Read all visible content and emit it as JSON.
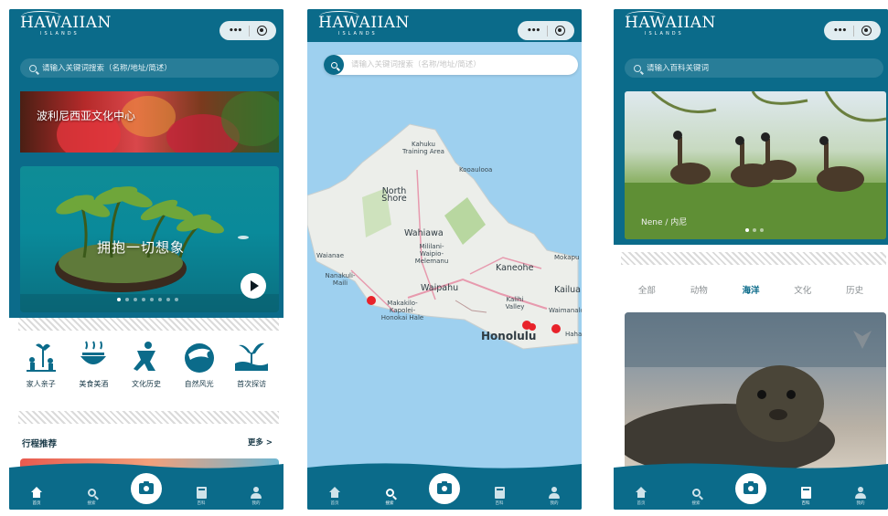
{
  "screens": [
    {
      "logo": {
        "main": "HAWAIIAN",
        "sub": "ISLANDS"
      },
      "search_placeholder": "请输入关键词搜索（名称/地址/简述）",
      "banner_title": "波利尼西亚文化中心",
      "hero_title": "拥抱一切想象",
      "carousel_dot_count": 8,
      "categories": [
        {
          "label": "家人亲子",
          "icon": "family-icon"
        },
        {
          "label": "美食美酒",
          "icon": "food-icon"
        },
        {
          "label": "文化历史",
          "icon": "culture-icon"
        },
        {
          "label": "自然风光",
          "icon": "nature-icon"
        },
        {
          "label": "首次探访",
          "icon": "first-visit-icon"
        }
      ],
      "section_title": "行程推荐",
      "more_label": "更多 >",
      "tabbar": [
        "首页",
        "搜索",
        "",
        "百科",
        "我的"
      ],
      "active_tab": 0
    },
    {
      "logo": {
        "main": "HAWAIIAN",
        "sub": "ISLANDS"
      },
      "search_placeholder": "请输入关键词搜索（名称/地址/简述）",
      "map_places": [
        "Kahuku Training Area",
        "Kooaulooa",
        "North Shore",
        "Wahiawa",
        "Mililani-Waipio-Melemanu",
        "Waianae",
        "Nanakuli-Maili",
        "Makakilo-Kapolei-Honokai Hale",
        "Waipahu",
        "Kaneohe",
        "Mokapu",
        "Kailua",
        "Kalihi Valley",
        "Waimanalo",
        "Hahaione",
        "Honolulu"
      ],
      "tabbar": [
        "首页",
        "搜索",
        "",
        "百科",
        "我的"
      ],
      "active_tab": 1
    },
    {
      "logo": {
        "main": "HAWAIIAN",
        "sub": "ISLANDS"
      },
      "search_placeholder": "请输入百科关键词",
      "photo_caption": "Nene / 内尼",
      "kb_tabs": [
        "全部",
        "动物",
        "海洋",
        "文化",
        "历史"
      ],
      "active_kb_tab": 2,
      "tabbar": [
        "首页",
        "搜索",
        "",
        "百科",
        "我的"
      ],
      "active_tab": 3
    }
  ],
  "colors": {
    "brand": "#0b6b8a",
    "map_water": "#9ed0ef",
    "pin": "#e8222a"
  }
}
